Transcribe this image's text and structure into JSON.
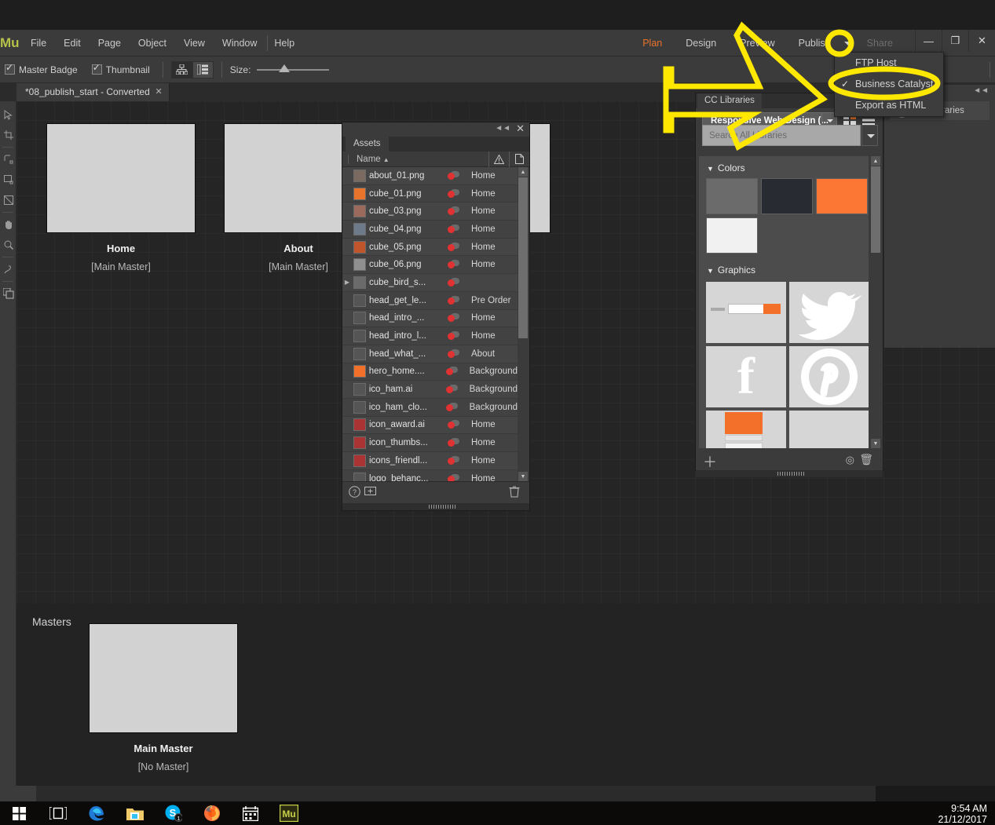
{
  "app": {
    "logo": "Mu",
    "name": "Adobe Muse"
  },
  "menubar": {
    "items": [
      "File",
      "Edit",
      "Page",
      "Object",
      "View",
      "Window",
      "Help"
    ],
    "workspace": [
      {
        "label": "Plan",
        "state": "active"
      },
      {
        "label": "Design",
        "state": "normal"
      },
      {
        "label": "Preview",
        "state": "normal"
      },
      {
        "label": "Publish",
        "state": "normal"
      },
      {
        "label": "Share",
        "state": "disabled"
      }
    ],
    "accent_color": "#e8732b"
  },
  "window_controls": {
    "minimize": "—",
    "restore": "❐",
    "close": "✕"
  },
  "publish_menu": {
    "items": [
      {
        "label": "FTP Host",
        "checked": false
      },
      {
        "label": "Business Catalyst",
        "checked": true
      },
      {
        "label": "Export as HTML",
        "checked": false
      }
    ],
    "check_glyph": "✓"
  },
  "options_bar": {
    "master_badge": {
      "label": "Master Badge",
      "checked": true
    },
    "thumbnail": {
      "label": "Thumbnail",
      "checked": true
    },
    "size_label": "Size:",
    "size_value": 35,
    "view_modes": [
      "plan-view-icon",
      "list-view-icon"
    ],
    "selected_view": 1
  },
  "document_tab": {
    "title": "*08_publish_start - Converted",
    "close": "✕"
  },
  "toolbar": {
    "tools": [
      "selection-tool",
      "crop-tool",
      "rectangle-tool",
      "rounded-rect-tool",
      "ellipse-tool",
      "text-tool",
      "hand-tool",
      "zoom-tool",
      "pen-tool",
      "swatch-tool",
      "color-tool"
    ]
  },
  "plan": {
    "pages": [
      {
        "name": "Home",
        "master": "[Main Master]"
      },
      {
        "name": "About",
        "master": "[Main Master]"
      },
      {
        "name": "",
        "master": ""
      }
    ],
    "masters_label": "Masters",
    "masters": [
      {
        "name": "Main Master",
        "master": "[No Master]"
      }
    ]
  },
  "assets_panel": {
    "tab": "Assets",
    "collapse_glyph": "◄◄",
    "close_glyph": "✕",
    "columns": {
      "name": "Name",
      "sort": "▲",
      "warning": "⚠",
      "file": "📄"
    },
    "rows": [
      {
        "name": "about_01.png",
        "page": "Home",
        "expandable": false,
        "thumb": "#7a6a60"
      },
      {
        "name": "cube_01.png",
        "page": "Home",
        "expandable": false,
        "thumb": "#e8732b"
      },
      {
        "name": "cube_03.png",
        "page": "Home",
        "expandable": false,
        "thumb": "#9b6a5c"
      },
      {
        "name": "cube_04.png",
        "page": "Home",
        "expandable": false,
        "thumb": "#6d7a8a"
      },
      {
        "name": "cube_05.png",
        "page": "Home",
        "expandable": false,
        "thumb": "#c0552b"
      },
      {
        "name": "cube_06.png",
        "page": "Home",
        "expandable": false,
        "thumb": "#8f8f8f"
      },
      {
        "name": "cube_bird_s...",
        "page": "",
        "expandable": true,
        "thumb": "#6a6a6a"
      },
      {
        "name": "head_get_le...",
        "page": "Pre Order",
        "expandable": false,
        "thumb": "#555555"
      },
      {
        "name": "head_intro_...",
        "page": "Home",
        "expandable": false,
        "thumb": "#555555"
      },
      {
        "name": "head_intro_l...",
        "page": "Home",
        "expandable": false,
        "thumb": "#555555"
      },
      {
        "name": "head_what_...",
        "page": "About",
        "expandable": false,
        "thumb": "#555555"
      },
      {
        "name": "hero_home....",
        "page": "Background",
        "expandable": false,
        "thumb": "#f2702a"
      },
      {
        "name": "ico_ham.ai",
        "page": "Background",
        "expandable": false,
        "thumb": "#555555"
      },
      {
        "name": "ico_ham_clo...",
        "page": "Background",
        "expandable": false,
        "thumb": "#555555"
      },
      {
        "name": "icon_award.ai",
        "page": "Home",
        "expandable": false,
        "thumb": "#a33"
      },
      {
        "name": "icon_thumbs...",
        "page": "Home",
        "expandable": false,
        "thumb": "#a33"
      },
      {
        "name": "icons_friendl...",
        "page": "Home",
        "expandable": false,
        "thumb": "#a33"
      },
      {
        "name": "logo_behanc...",
        "page": "Home",
        "expandable": false,
        "thumb": "#555555"
      }
    ],
    "footer": {
      "help": "?",
      "add": "＋",
      "delete": "🗑"
    }
  },
  "cc_libraries": {
    "tab": "CC Libraries",
    "library_name": "Responsive Web Design (...",
    "search_placeholder": "Search All Libraries",
    "view_icons": [
      "grid-view-icon",
      "list-view-icon"
    ],
    "sections": [
      {
        "title": "Colors",
        "tri": "▼",
        "swatches": [
          "#6b6b6b",
          "#282b32",
          "#fc7734",
          "#f1f1f1"
        ]
      },
      {
        "title": "Graphics",
        "tri": "▼",
        "items": [
          {
            "kind": "form-mockup",
            "glyph": ""
          },
          {
            "kind": "twitter-logo",
            "glyph": "🐦"
          },
          {
            "kind": "facebook-logo",
            "glyph": "f"
          },
          {
            "kind": "pinterest-logo",
            "glyph": "𝐏"
          },
          {
            "kind": "page-mockup",
            "glyph": ""
          },
          {
            "kind": "empty-graphic",
            "glyph": ""
          }
        ]
      }
    ],
    "footer": {
      "add": "＋",
      "cc_sync": "◎",
      "delete": "🗑"
    }
  },
  "right_dock": {
    "collapse_glyph": "◄◄",
    "items": [
      {
        "label": "CC Libraries",
        "icon": "cc-libraries-icon"
      }
    ]
  },
  "annotation": {
    "color": "#ffe800",
    "shapes": [
      "right-arrow-outline",
      "ellipse-around-business-catalyst",
      "ellipse-around-publish-caret"
    ]
  },
  "taskbar": {
    "icons": [
      "windows-start-icon",
      "task-view-icon",
      "edge-icon",
      "file-explorer-icon",
      "skype-icon",
      "firefox-icon",
      "calendar-icon",
      "muse-icon"
    ],
    "clock_time": "9:54 AM",
    "clock_date": "21/12/2017"
  }
}
